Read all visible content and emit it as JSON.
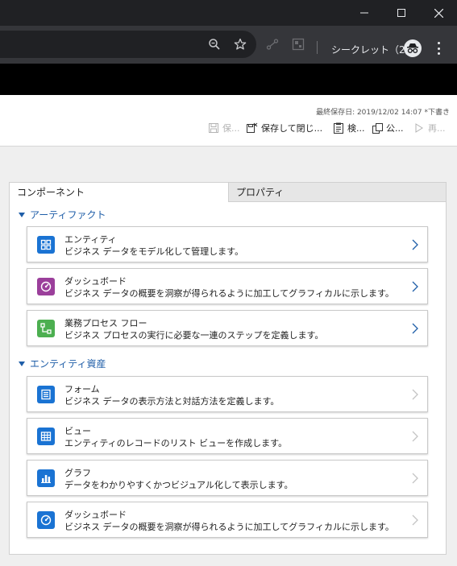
{
  "browser": {
    "incognito_label": "シークレット（2）",
    "icons": {
      "minimize": "minimize-icon",
      "maximize": "maximize-icon",
      "close": "close-icon",
      "zoom": "zoom-icon",
      "star": "star-icon",
      "extension_1": "extension-icon",
      "extension_2": "extension-grid-icon",
      "incognito": "incognito-icon",
      "menu": "kebab-menu-icon"
    }
  },
  "command_bar": {
    "last_saved": "最終保存日: 2019/12/02 14:07 *下書き",
    "buttons": [
      {
        "label": "保...",
        "icon": "save-icon",
        "enabled": false
      },
      {
        "label": "保存して閉じ...",
        "icon": "save-close-icon",
        "enabled": true
      },
      {
        "label": "検...",
        "icon": "validate-icon",
        "enabled": true
      },
      {
        "label": "公...",
        "icon": "publish-icon",
        "enabled": true
      },
      {
        "label": "再...",
        "icon": "play-icon",
        "enabled": false
      }
    ]
  },
  "panel": {
    "tabs": [
      {
        "label": "コンポーネント",
        "active": true
      },
      {
        "label": "プロパティ",
        "active": false
      }
    ],
    "sections": [
      {
        "title": "アーティファクト",
        "items": [
          {
            "title": "エンティティ",
            "description": "ビジネス データをモデル化して管理します。",
            "icon": "entity-icon",
            "icon_color": "#1a73d3",
            "chevron_color": "#1f5ea8"
          },
          {
            "title": "ダッシュボード",
            "description": "ビジネス データの概要を洞察が得られるように加工してグラフィカルに示します。",
            "icon": "dashboard-icon",
            "icon_color": "#9b3f9b",
            "chevron_color": "#1f5ea8"
          },
          {
            "title": "業務プロセス フロー",
            "description": "ビジネス プロセスの実行に必要な一連のステップを定義します。",
            "icon": "process-flow-icon",
            "icon_color": "#4caf50",
            "chevron_color": "#1f5ea8"
          }
        ]
      },
      {
        "title": "エンティティ資産",
        "items": [
          {
            "title": "フォーム",
            "description": "ビジネス データの表示方法と対話方法を定義します。",
            "icon": "form-icon",
            "icon_color": "#1a73d3",
            "chevron_color": "#c4c4c4"
          },
          {
            "title": "ビュー",
            "description": "エンティティのレコードのリスト ビューを作成します。",
            "icon": "view-grid-icon",
            "icon_color": "#1a73d3",
            "chevron_color": "#c4c4c4"
          },
          {
            "title": "グラフ",
            "description": "データをわかりやすくかつビジュアル化して表示します。",
            "icon": "chart-icon",
            "icon_color": "#1a73d3",
            "chevron_color": "#c4c4c4"
          },
          {
            "title": "ダッシュボード",
            "description": "ビジネス データの概要を洞察が得られるように加工してグラフィカルに示します。",
            "icon": "dashboard-icon",
            "icon_color": "#1a73d3",
            "chevron_color": "#c4c4c4"
          }
        ]
      }
    ]
  }
}
